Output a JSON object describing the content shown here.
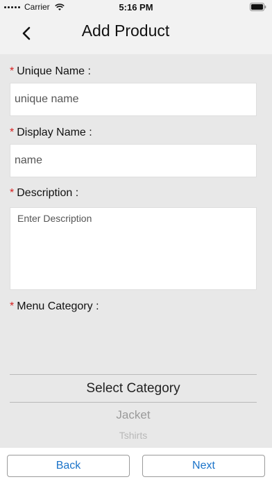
{
  "status_bar": {
    "carrier": "Carrier",
    "time": "5:16 PM"
  },
  "nav": {
    "title": "Add Product",
    "back_icon": "chevron-left-icon"
  },
  "form": {
    "required_marker": "*",
    "unique_name": {
      "label": "Unique Name :",
      "placeholder": "unique name",
      "value": ""
    },
    "display_name": {
      "label": "Display Name :",
      "placeholder": "name",
      "value": ""
    },
    "description": {
      "label": "Description :",
      "placeholder": "Enter Description",
      "value": ""
    },
    "menu_category": {
      "label": "Menu Category :",
      "selected": "Select Category",
      "options": [
        "Jacket",
        "Tshirts"
      ]
    }
  },
  "buttons": {
    "back": "Back",
    "next": "Next"
  },
  "colors": {
    "accent": "#1a73c9",
    "required": "#d62020",
    "background": "#e8e8e8"
  }
}
